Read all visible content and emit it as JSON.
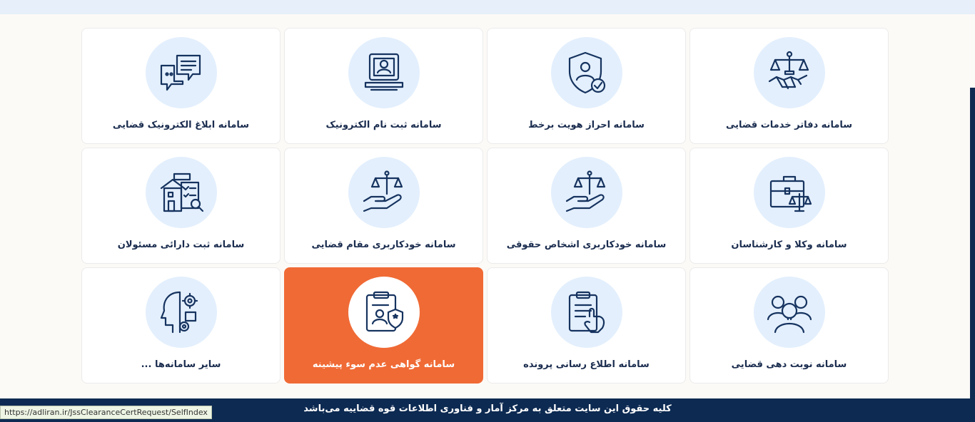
{
  "cards": [
    {
      "label": "سامانه دفاتر خدمات قضایی",
      "icon": "scales-handshake-icon"
    },
    {
      "label": "سامانه احراز هویت برخط",
      "icon": "shield-user-check-icon"
    },
    {
      "label": "سامانه ثبت نام الکترونیک",
      "icon": "laptop-user-icon"
    },
    {
      "label": "سامانه ابلاغ الکترونیک قضایی",
      "icon": "chat-bubbles-icon"
    },
    {
      "label": "سامانه وکلا و کارشناسان",
      "icon": "briefcase-scales-icon"
    },
    {
      "label": "سامانه خودکاربری اشخاص حقوقی",
      "icon": "hand-scales-icon"
    },
    {
      "label": "سامانه خودکاربری مقام قضایی",
      "icon": "hand-scales-icon"
    },
    {
      "label": "سامانه ثبت دارائی مسئولان",
      "icon": "building-document-search-icon"
    },
    {
      "label": "سامانه نوبت دهی قضایی",
      "icon": "people-group-icon"
    },
    {
      "label": "سامانه اطلاع رسانی پرونده",
      "icon": "clipboard-tap-icon"
    },
    {
      "label": "سامانه گواهی عدم سوء پیشینه",
      "icon": "clipboard-badge-icon",
      "active": true
    },
    {
      "label": "سایر سامانه‌ها ...",
      "icon": "head-gears-icon"
    }
  ],
  "footer": {
    "text": "کلیه حقوق این سایت متعلق به مرکز آمار و فناوری اطلاعات قوه قضاییه می‌باشد"
  },
  "status_bar": {
    "url": "https://adliran.ir/JssClearanceCertRequest/SelfIndex"
  },
  "colors": {
    "accent": "#f06a35",
    "navy": "#0d2a52",
    "icon_bg": "#e3effd",
    "icon_stroke": "#16335f"
  }
}
